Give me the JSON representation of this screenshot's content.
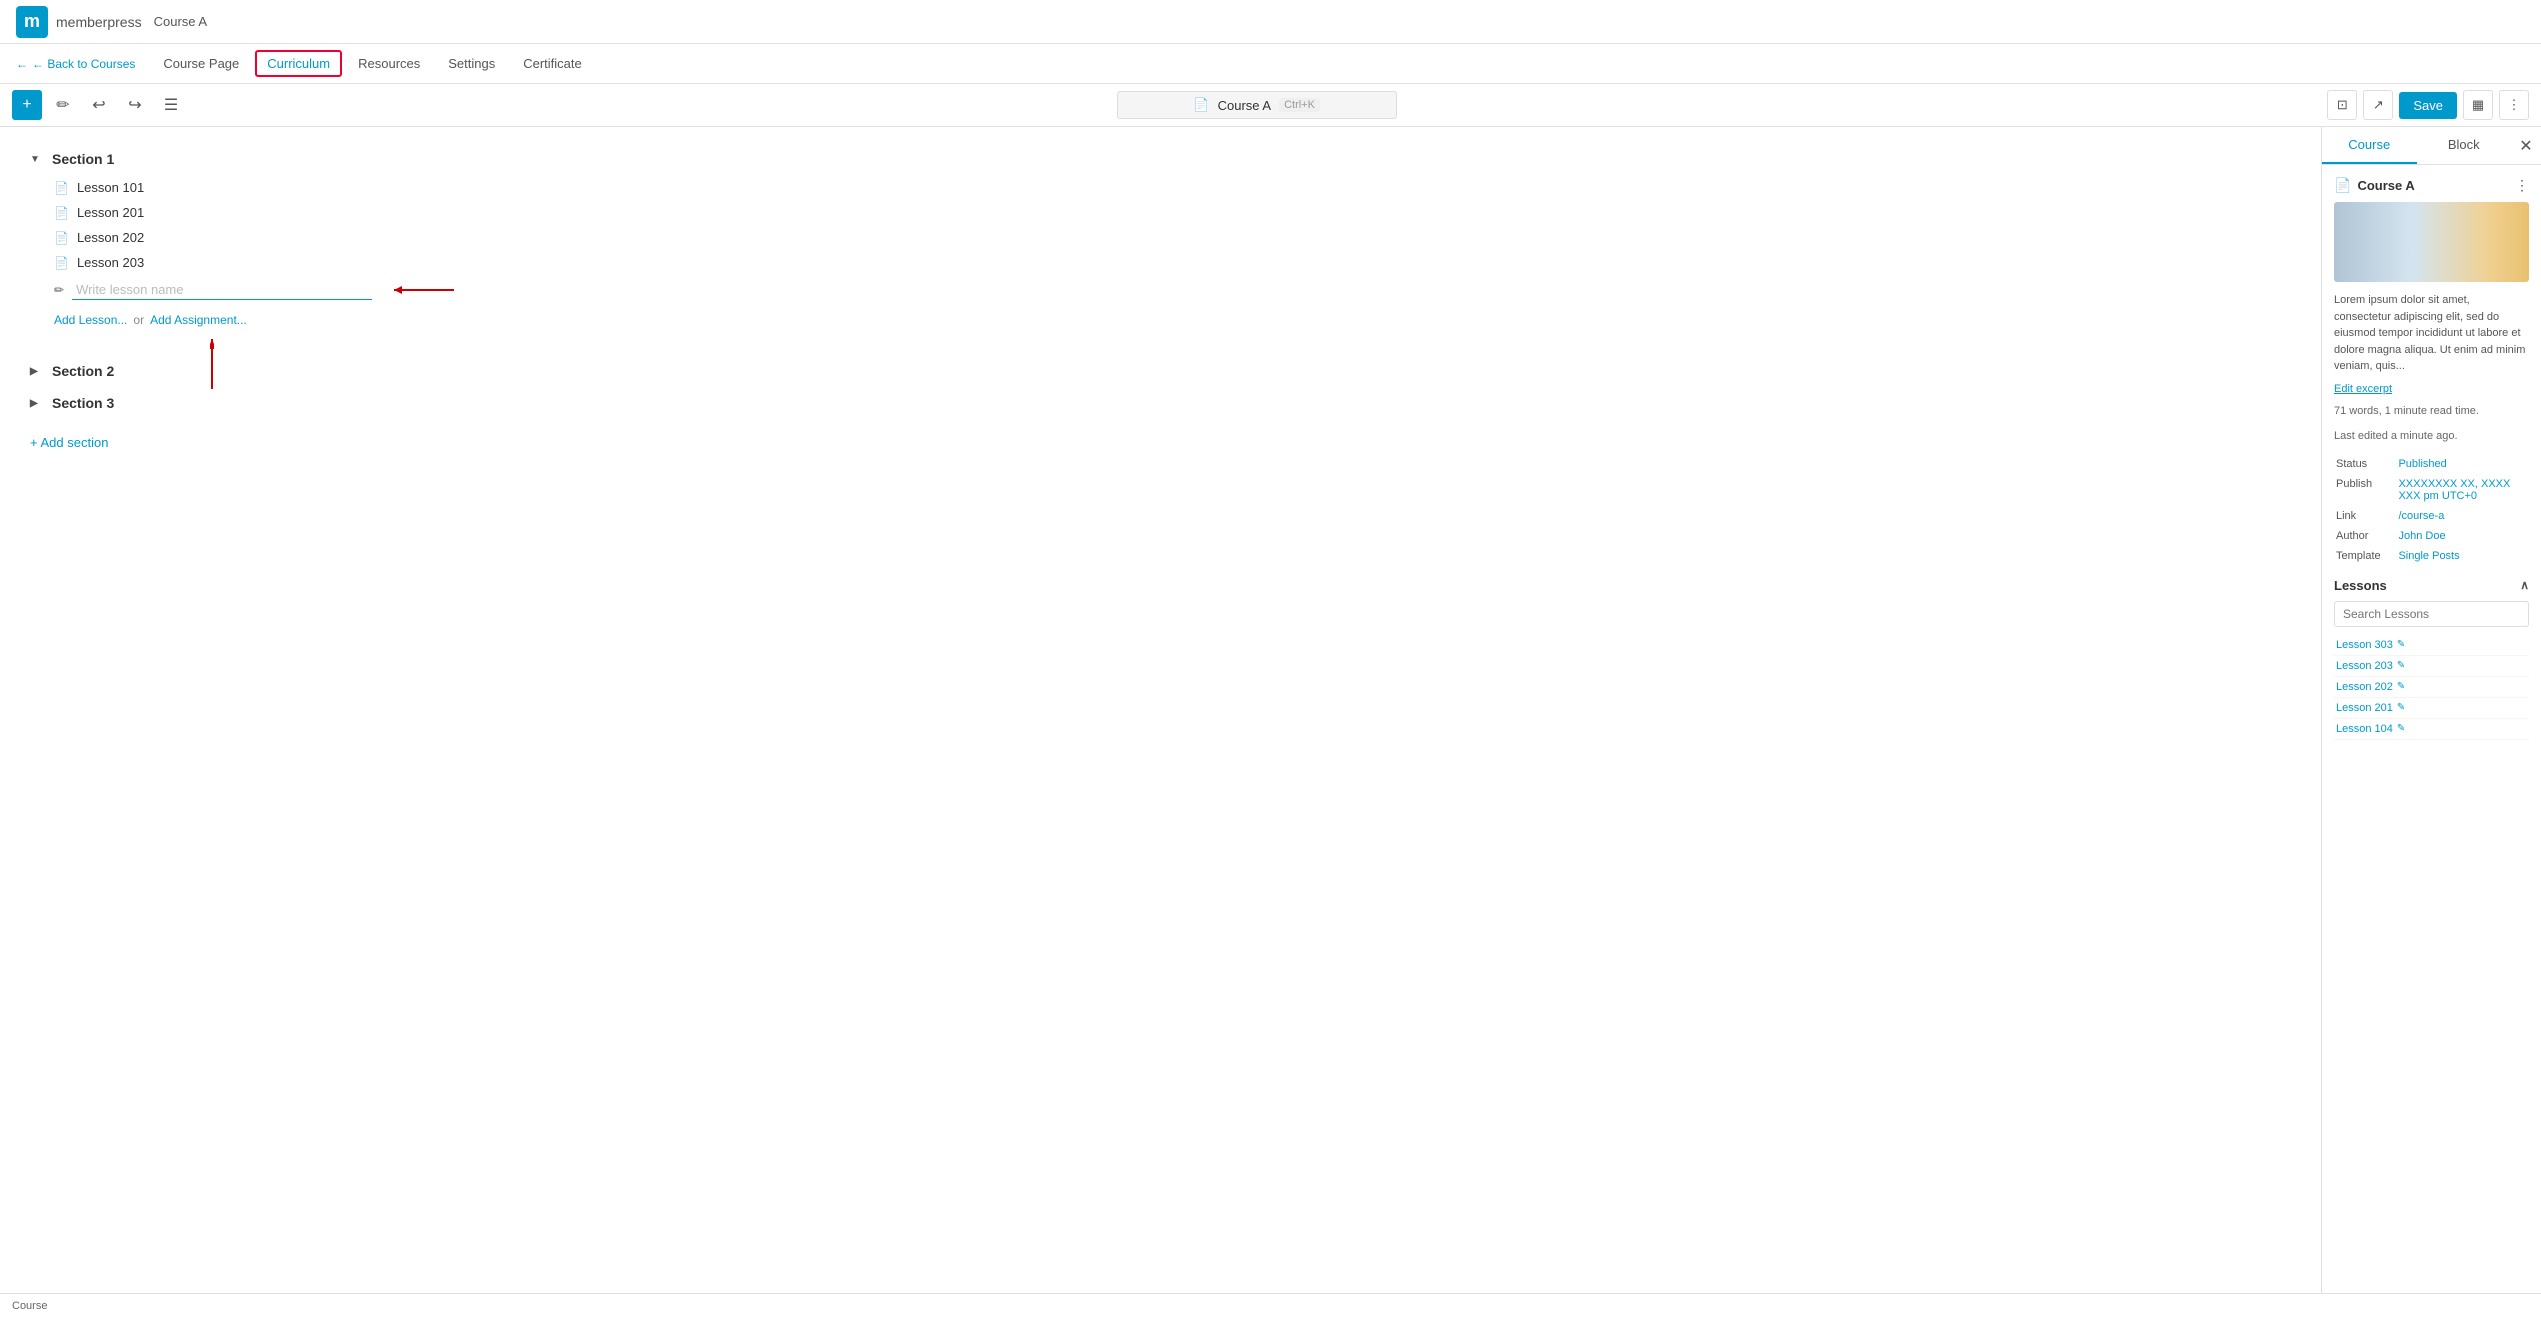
{
  "topbar": {
    "logo_letter": "m",
    "brand_name": "memberpress",
    "course_name": "Course A"
  },
  "nav": {
    "back_label": "← Back to Courses",
    "tabs": [
      {
        "id": "course-page",
        "label": "Course Page",
        "active": false
      },
      {
        "id": "curriculum",
        "label": "Curriculum",
        "active": true
      },
      {
        "id": "resources",
        "label": "Resources",
        "active": false
      },
      {
        "id": "settings",
        "label": "Settings",
        "active": false
      },
      {
        "id": "certificate",
        "label": "Certificate",
        "active": false
      }
    ]
  },
  "toolbar": {
    "plus_label": "+",
    "doc_title": "Course A",
    "shortcut": "Ctrl+K",
    "save_label": "Save"
  },
  "curriculum": {
    "sections": [
      {
        "id": "section-1",
        "label": "Section 1",
        "expanded": true,
        "lessons": [
          {
            "id": "lesson-101",
            "name": "Lesson 101"
          },
          {
            "id": "lesson-201",
            "name": "Lesson 201"
          },
          {
            "id": "lesson-202",
            "name": "Lesson 202"
          },
          {
            "id": "lesson-203",
            "name": "Lesson 203"
          }
        ]
      },
      {
        "id": "section-2",
        "label": "Section 2",
        "expanded": false,
        "lessons": []
      },
      {
        "id": "section-3",
        "label": "Section 3",
        "expanded": false,
        "lessons": []
      }
    ],
    "new_lesson_placeholder": "Write lesson name",
    "add_lesson_label": "Add Lesson...",
    "add_lesson_or": "or",
    "add_assignment_label": "Add Assignment...",
    "add_section_label": "+ Add section"
  },
  "right_panel": {
    "tabs": [
      {
        "id": "course-tab",
        "label": "Course",
        "active": true
      },
      {
        "id": "block-tab",
        "label": "Block",
        "active": false
      }
    ],
    "course": {
      "title": "Course A",
      "doc_icon": "📄",
      "description": "Lorem ipsum dolor sit amet, consectetur adipiscing elit, sed do eiusmod tempor incididunt ut labore et dolore magna aliqua. Ut enim ad minim veniam, quis...",
      "edit_excerpt": "Edit excerpt",
      "meta_words": "71 words, 1 minute read time.",
      "meta_edited": "Last edited a minute ago.",
      "status_label": "Status",
      "status_value": "Published",
      "publish_label": "Publish",
      "publish_value": "XXXXXXXX XX, XXXX\nXXX pm UTC+0",
      "link_label": "Link",
      "link_value": "/course-a",
      "author_label": "Author",
      "author_value": "John Doe",
      "template_label": "Template",
      "template_value": "Single Posts"
    },
    "lessons": {
      "header": "Lessons",
      "search_placeholder": "Search Lessons",
      "items": [
        {
          "id": "lesson-303",
          "name": "Lesson 303"
        },
        {
          "id": "lesson-203",
          "name": "Lesson 203"
        },
        {
          "id": "lesson-202",
          "name": "Lesson 202"
        },
        {
          "id": "lesson-201",
          "name": "Lesson 201"
        },
        {
          "id": "lesson-104",
          "name": "Lesson 104"
        }
      ]
    }
  },
  "status_bar": {
    "label": "Course"
  }
}
